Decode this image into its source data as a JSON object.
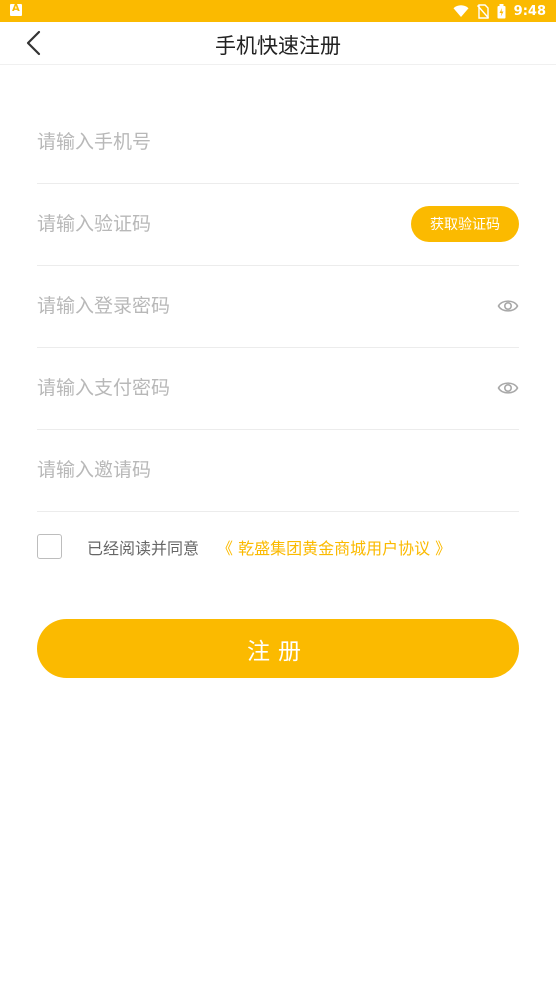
{
  "status_bar": {
    "time": "9:48",
    "icons": [
      "app-notification-icon",
      "wifi-icon",
      "no-sim-icon",
      "battery-icon"
    ]
  },
  "header": {
    "title": "手机快速注册",
    "back_icon": "chevron-left-icon"
  },
  "form": {
    "phone_placeholder": "请输入手机号",
    "code_placeholder": "请输入验证码",
    "get_code_label": "获取验证码",
    "login_password_placeholder": "请输入登录密码",
    "pay_password_placeholder": "请输入支付密码",
    "invite_code_placeholder": "请输入邀请码"
  },
  "agreement": {
    "checked": false,
    "text": "已经阅读并同意",
    "link": "《 乾盛集团黄金商城用户协议 》"
  },
  "submit_label": "注册",
  "colors": {
    "accent": "#FBBA00",
    "placeholder": "#B8B8B8",
    "divider": "#ECECEC"
  }
}
